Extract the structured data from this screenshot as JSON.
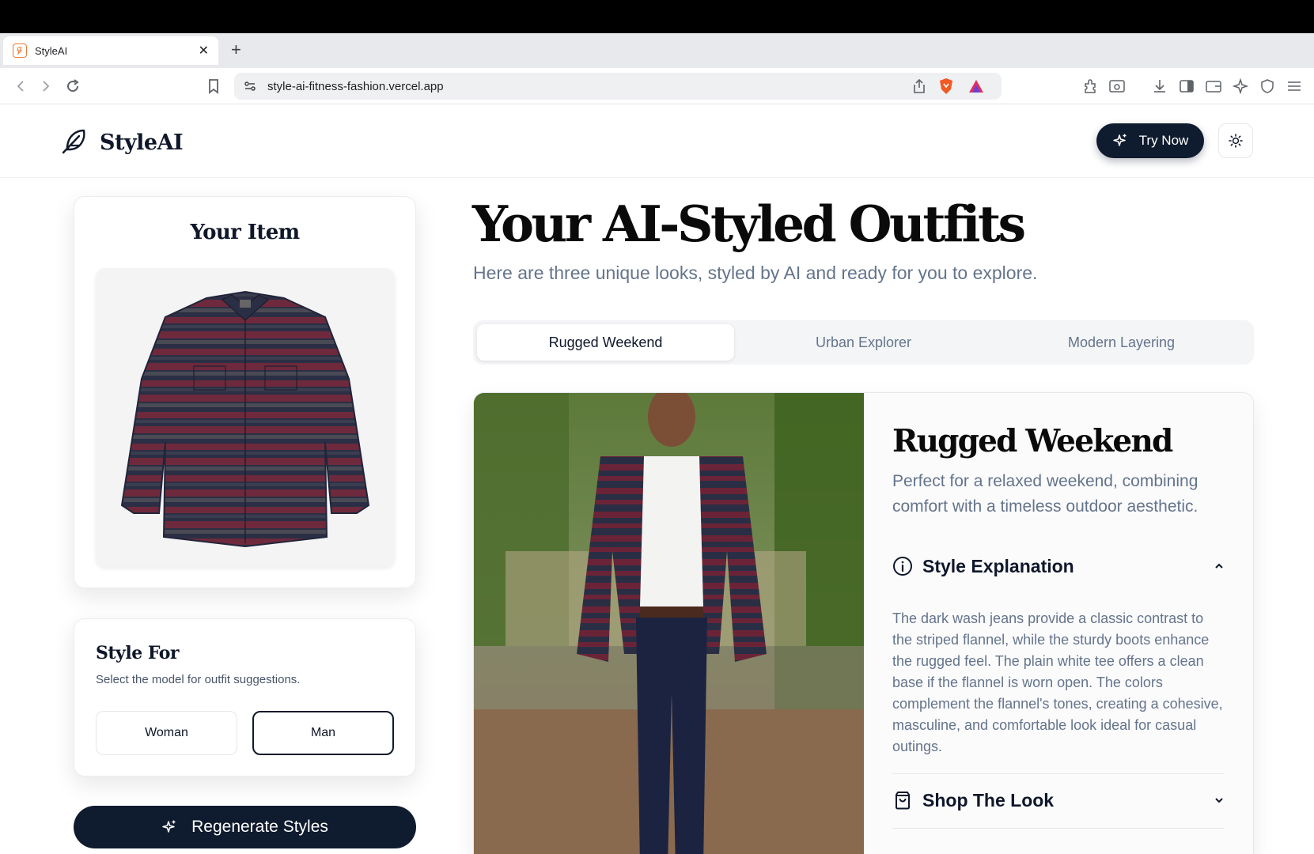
{
  "browser": {
    "tab_title": "StyleAI",
    "url": "style-ai-fitness-fashion.vercel.app"
  },
  "header": {
    "brand": "StyleAI",
    "try_now": "Try Now"
  },
  "item_panel": {
    "title": "Your Item"
  },
  "style_for": {
    "title": "Style For",
    "subtitle": "Select the model for outfit suggestions.",
    "options": [
      "Woman",
      "Man"
    ],
    "selected": "Man"
  },
  "regenerate_label": "Regenerate Styles",
  "main": {
    "title": "Your AI-Styled Outfits",
    "subtitle": "Here are three unique looks, styled by AI and ready for you to explore.",
    "tabs": [
      {
        "label": "Rugged Weekend",
        "active": true
      },
      {
        "label": "Urban Explorer",
        "active": false
      },
      {
        "label": "Modern Layering",
        "active": false
      }
    ]
  },
  "outfit": {
    "name": "Rugged Weekend",
    "description": "Perfect for a relaxed weekend, combining comfort with a timeless outdoor aesthetic.",
    "explanation_title": "Style Explanation",
    "explanation": "The dark wash jeans provide a classic contrast to the striped flannel, while the sturdy boots enhance the rugged feel. The plain white tee offers a clean base if the flannel is worn open. The colors complement the flannel's tones, creating a cohesive, masculine, and comfortable look ideal for casual outings.",
    "shop_title": "Shop The Look"
  },
  "colors": {
    "primary_dark": "#0f1b2e",
    "muted_text": "#64748b",
    "favicon_accent": "#ea7a3a"
  }
}
